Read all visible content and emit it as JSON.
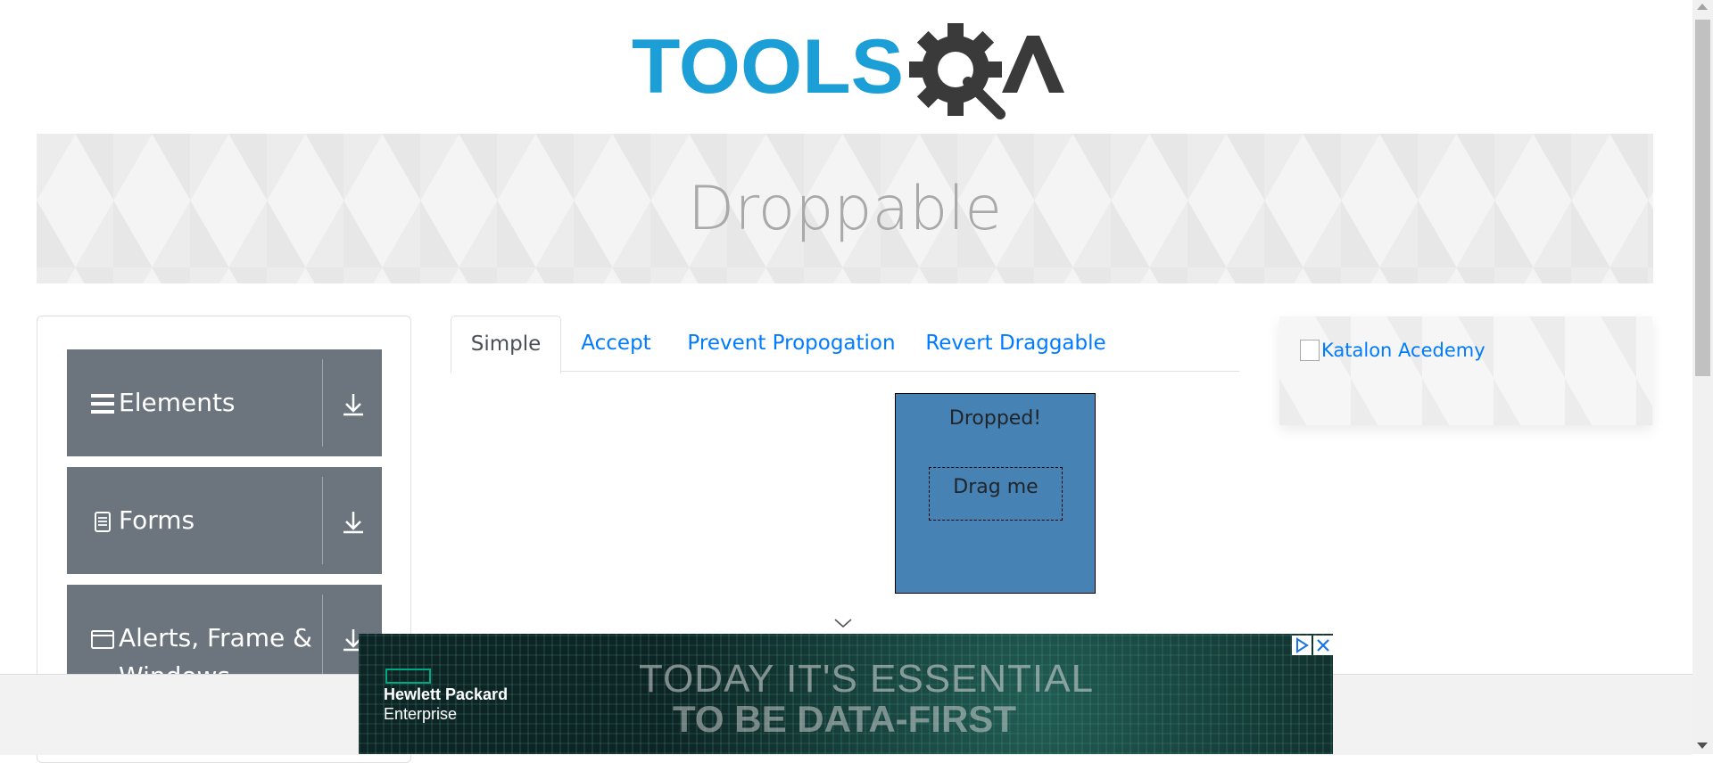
{
  "header": {
    "logo_text": "TOOLSQA"
  },
  "banner": {
    "title": "Droppable"
  },
  "sidebar": {
    "groups": [
      {
        "label": "Elements",
        "icon": "menu-icon"
      },
      {
        "label": "Forms",
        "icon": "document-icon"
      },
      {
        "label": "Alerts, Frame & Windows",
        "icon": "window-icon"
      }
    ]
  },
  "tabs": [
    "Simple",
    "Accept",
    "Prevent Propogation",
    "Revert Draggable"
  ],
  "active_tab": "Simple",
  "droppable": {
    "drop_text": "Dropped!",
    "drop_color": "#4682b4",
    "drag_text": "Drag me"
  },
  "right_ad": {
    "alt_text": "Katalon Acedemy"
  },
  "bottom_ad": {
    "brand_line1": "Hewlett Packard",
    "brand_line2": "Enterprise",
    "headline1": "TODAY IT'S ESSENTIAL",
    "headline2": "TO BE DATA-FIRST"
  },
  "colors": {
    "brand_blue": "#1c9fd6",
    "sidebar_gray": "#6c757d",
    "link_blue": "#007bff"
  }
}
